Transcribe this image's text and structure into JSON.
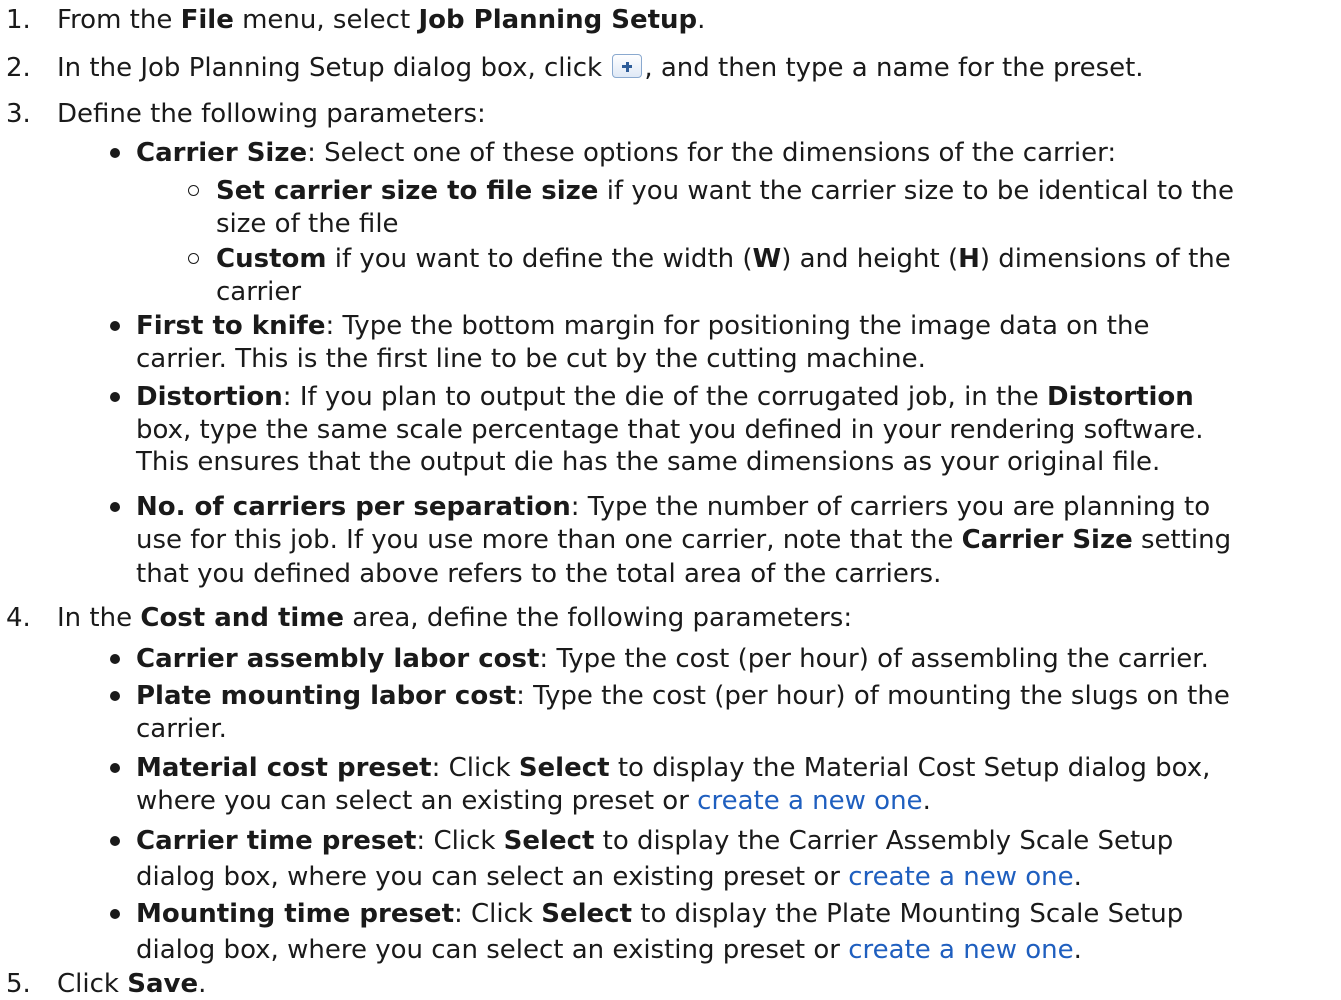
{
  "steps": {
    "s1": {
      "num": "1.",
      "a": "From the ",
      "b1": "File",
      "c": " menu, select ",
      "b2": "Job Planning Setup",
      "d": "."
    },
    "s2": {
      "num": "2.",
      "a": "In the Job Planning Setup dialog box, click ",
      "icon": "plus-icon",
      "b": ", and then type a name for the preset."
    },
    "s3": {
      "num": "3.",
      "a": "Define the following parameters:"
    },
    "s4": {
      "num": "4.",
      "a": "In the ",
      "b1": "Cost and time",
      "c": " area, define the following parameters:"
    },
    "s5": {
      "num": "5.",
      "a": "Click ",
      "b1": "Save",
      "c": "."
    }
  },
  "params": {
    "carrier_size": {
      "label": "Carrier Size",
      "text": ": Select one of these options for the dimensions of the carrier:"
    },
    "opt_file": {
      "label": "Set carrier size to file size",
      "l1": " if you want the carrier size to be identical to the",
      "l2": "size of the file"
    },
    "opt_custom": {
      "label": "Custom",
      "a": " if you want to define the width (",
      "w": "W",
      "b": ") and height (",
      "h": "H",
      "c": ") dimensions of the",
      "l2": "carrier"
    },
    "first_knife": {
      "label": "First to knife",
      "l1": ": Type the bottom margin for positioning the image data on the",
      "l2": "carrier. This is the first line to be cut by the cutting machine."
    },
    "distortion": {
      "label": "Distortion",
      "a": ": If you plan to output the die of the corrugated job, in the ",
      "b": "Distortion",
      "l2": "box, type the same scale percentage that you defined in your rendering software.",
      "l3": "This ensures that the output die has the same dimensions as your original file."
    },
    "carriers": {
      "label": "No. of carriers per separation",
      "l1": ": Type the number of carriers you are planning to",
      "l2a": "use for this job. If you use more than one carrier, note that the ",
      "l2b": "Carrier Size",
      "l2c": " setting",
      "l3": "that you defined above refers to the total area of the carriers."
    }
  },
  "cost": {
    "assembly": {
      "label": "Carrier assembly labor cost",
      "text": ": Type the cost (per hour) of assembling the carrier."
    },
    "mounting": {
      "label": "Plate mounting labor cost",
      "l1": ": Type the cost (per hour) of mounting the slugs on the",
      "l2": "carrier."
    },
    "material": {
      "label": "Material cost preset",
      "a": ": Click ",
      "sel": "Select",
      "b": " to display the Material Cost Setup dialog box,",
      "l2": "where you can select an existing preset or ",
      "link": "create a new one",
      "end": "."
    },
    "carrier_time": {
      "label": "Carrier time preset",
      "a": ": Click ",
      "sel": "Select",
      "b": " to display the Carrier Assembly Scale Setup",
      "l2": "dialog box, where you can select an existing preset or ",
      "link": "create a new one",
      "end": "."
    },
    "mount_time": {
      "label": "Mounting time preset",
      "a": ": Click ",
      "sel": "Select",
      "b": " to display the Plate Mounting Scale Setup",
      "l2": "dialog box, where you can select an existing preset or ",
      "link": "create a new one",
      "end": "."
    }
  },
  "colors": {
    "text": "#1a1a1a",
    "link": "#1f5fbf"
  }
}
